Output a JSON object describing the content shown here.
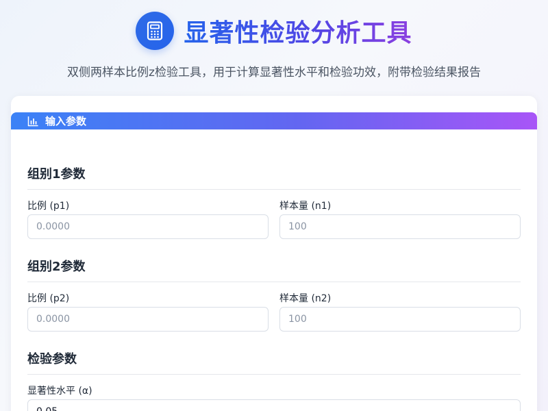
{
  "header": {
    "icon": "calculator-icon",
    "title": "显著性检验分析工具",
    "subtitle": "双侧两样本比例z检验工具，用于计算显著性水平和检验功效，附带检验结果报告"
  },
  "input_card": {
    "icon": "bar-chart-icon",
    "title": "输入参数",
    "group1": {
      "title": "组别1参数",
      "p_label": "比例 (p1)",
      "p_placeholder": "0.0000",
      "n_label": "样本量 (n1)",
      "n_placeholder": "100"
    },
    "group2": {
      "title": "组别2参数",
      "p_label": "比例 (p2)",
      "p_placeholder": "0.0000",
      "n_label": "样本量 (n2)",
      "n_placeholder": "100"
    },
    "test": {
      "title": "检验参数",
      "alpha_label": "显著性水平 (α)",
      "alpha_value": "0.05"
    }
  },
  "colors": {
    "brand_blue": "#2563eb",
    "brand_purple": "#a855f7"
  }
}
